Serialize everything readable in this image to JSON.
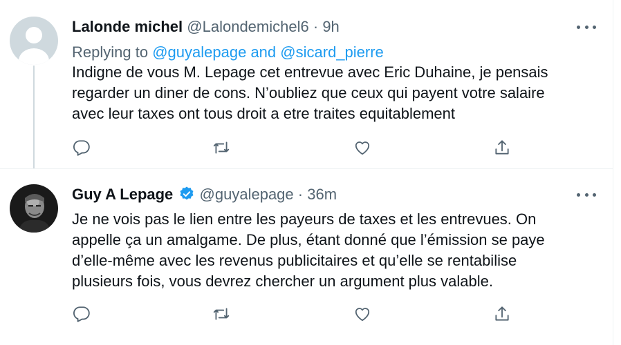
{
  "tweets": [
    {
      "author_name": "Lalonde michel",
      "handle": "@Lalondemichel6",
      "separator": "·",
      "time": "9h",
      "verified": false,
      "replying": {
        "prefix": "Replying to",
        "user1": "@guyalepage",
        "conjunction": "and",
        "user2": "@sicard_pierre"
      },
      "lines": [
        "Indigne de vous M. Lepage cet entrevue avec Eric Duhaine, je pensais",
        "regarder un diner de cons. N’oubliez que ceux qui payent votre salaire",
        "avec leur taxes ont tous droit a etre traites equitablement"
      ]
    },
    {
      "author_name": "Guy A Lepage",
      "handle": "@guyalepage",
      "separator": "·",
      "time": "36m",
      "verified": true,
      "lines": [
        "Je ne vois pas le lien entre les payeurs de taxes et les entrevues. On",
        "appelle ça un amalgame. De plus, étant donné que l’émission se paye",
        "d’elle-même avec les revenus publicitaires et qu’elle se rentabilise",
        "plusieurs fois, vous devrez chercher un argument plus valable."
      ]
    }
  ],
  "icons": {
    "more": "more-horizontal-icon",
    "reply": "reply-bubble-icon",
    "retweet": "retweet-arrows-icon",
    "like": "heart-icon",
    "share": "share-upload-icon",
    "verified": "verified-badge-icon"
  },
  "colors": {
    "text": "#0f1419",
    "secondary": "#536471",
    "link": "#1d9bf0",
    "verified": "#1d9bf0",
    "divider": "#eff3f4",
    "thread_line": "#cfd9de"
  }
}
